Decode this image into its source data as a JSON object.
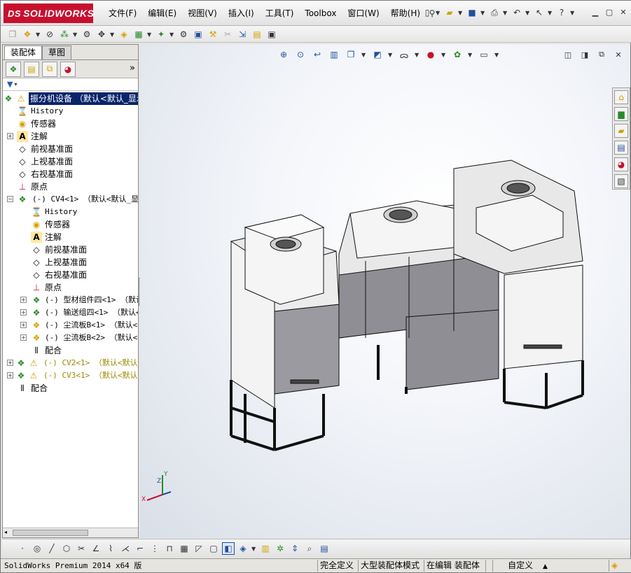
{
  "app": {
    "logo_mark": "DS",
    "logo_text": "SOLIDWORKS",
    "accent": "#c8102e",
    "selection_color": "#0a246a"
  },
  "menubar": {
    "items": [
      "文件(F)",
      "编辑(E)",
      "视图(V)",
      "插入(I)",
      "工具(T)",
      "Toolbox",
      "窗口(W)",
      "帮助(H)"
    ]
  },
  "panel": {
    "tabs": [
      "装配体",
      "草图"
    ],
    "more": "»"
  },
  "tree": {
    "root": "振分机设备  （默认<默认_显示",
    "history": "History",
    "sensors": "传感器",
    "annotations": "注解",
    "front_plane": "前视基准面",
    "top_plane": "上视基准面",
    "right_plane": "右视基准面",
    "origin": "原点",
    "cv4": "(-) CV4<1> （默认<默认_显示",
    "sub_history": "History",
    "sub_sensors": "传感器",
    "sub_annotations": "注解",
    "sub_front_plane": "前视基准面",
    "sub_top_plane": "上视基准面",
    "sub_right_plane": "右视基准面",
    "sub_origin": "原点",
    "profile_group": "(-) 型材组件四<1> （默认<",
    "conveyor_group": "(-) 输送组四<1> （默认<",
    "dust_plate1": "(-) 尘流板B<1> （默认<<",
    "dust_plate2": "(-) 尘流板B<2> （默认<<",
    "sub_mates": "配合",
    "cv2": "(-) CV2<1> （默认<默认_显",
    "cv3": "(-) CV3<1> （默认<默认_显",
    "mates": "配合"
  },
  "triad": {
    "x": "X",
    "y": "Y",
    "z": "Z"
  },
  "statusbar": {
    "product": "SolidWorks Premium 2014 x64 版",
    "defined": "完全定义",
    "mode": "大型装配体模式",
    "editing": "在编辑 装配体",
    "units": "自定义",
    "units_caret": "▲"
  }
}
